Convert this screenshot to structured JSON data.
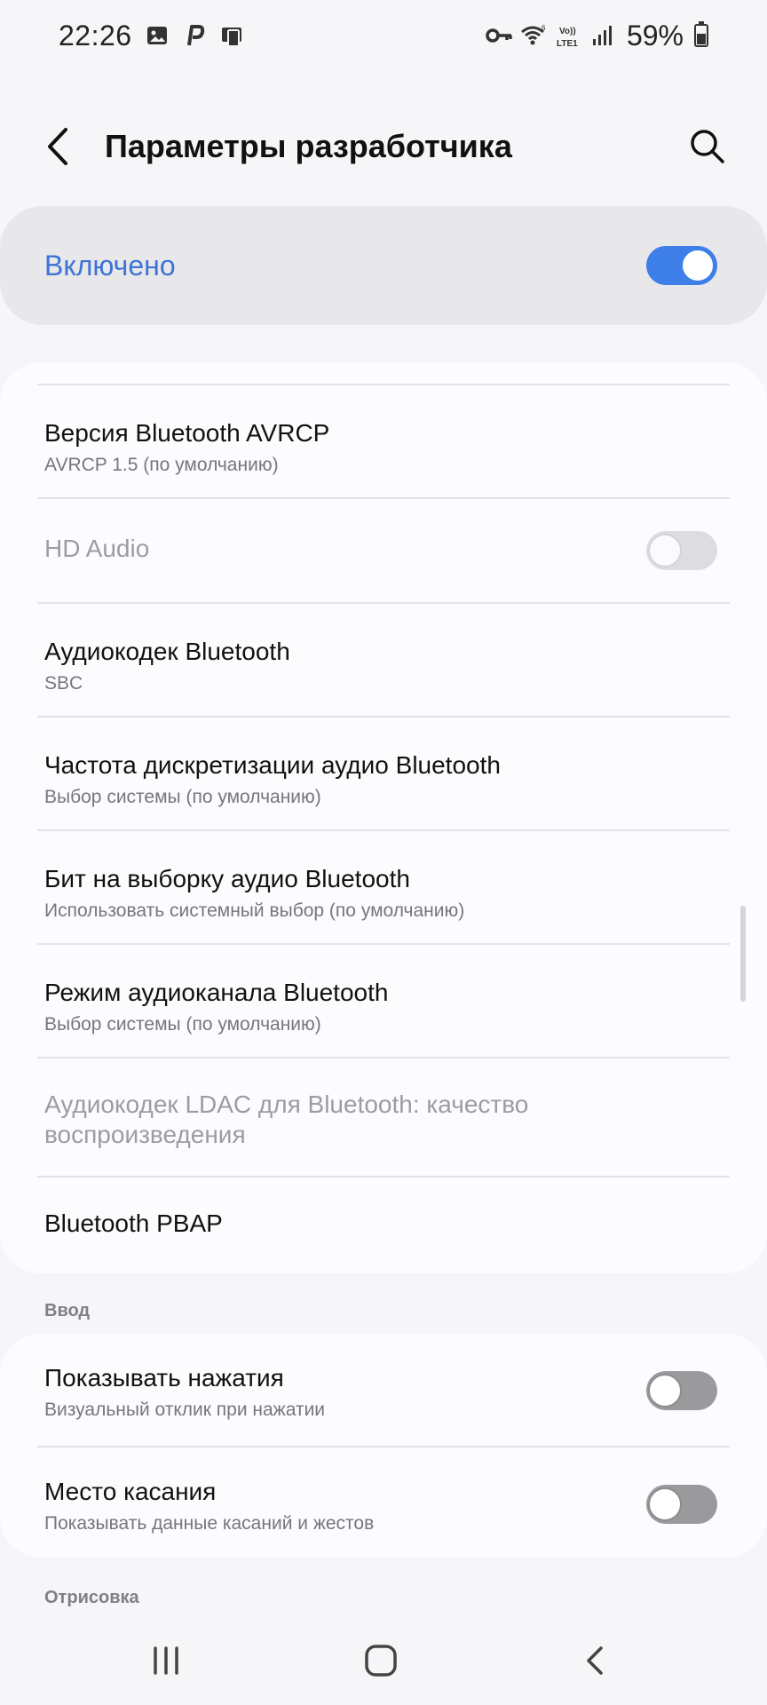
{
  "status_bar": {
    "time": "22:26",
    "battery": "59%",
    "left_icons": [
      "gallery-icon",
      "parking-icon",
      "device-icon"
    ],
    "right_icons": [
      "vpn-key-icon",
      "wifi-icon",
      "volte-icon",
      "signal-icon"
    ]
  },
  "header": {
    "title": "Параметры разработчика"
  },
  "master_switch": {
    "label": "Включено",
    "state": "on",
    "accent": "#3e74d6"
  },
  "bluetooth_items": [
    {
      "title": "Версия Bluetooth AVRCP",
      "subtitle": "AVRCP 1.5 (по умолчанию)"
    },
    {
      "title": "HD Audio",
      "toggle": "disabled"
    },
    {
      "title": "Аудиокодек Bluetooth",
      "subtitle": "SBC"
    },
    {
      "title": "Частота дискретизации аудио Bluetooth",
      "subtitle": "Выбор системы (по умолчанию)"
    },
    {
      "title": "Бит на выборку аудио Bluetooth",
      "subtitle": "Использовать системный выбор (по умолчанию)"
    },
    {
      "title": "Режим аудиоканала Bluetooth",
      "subtitle": "Выбор системы (по умолчанию)"
    },
    {
      "title_line1": "Аудиокодек LDAC для Bluetooth: качество",
      "title_line2": "воспроизведения",
      "enabled": false
    },
    {
      "title": "Bluetooth PBAP"
    }
  ],
  "input_section": {
    "label": "Ввод",
    "items": [
      {
        "title": "Показывать нажатия",
        "subtitle": "Визуальный отклик при нажатии",
        "toggle": "off"
      },
      {
        "title": "Место касания",
        "subtitle": "Показывать данные касаний и жестов",
        "toggle": "off"
      }
    ]
  },
  "drawing_section": {
    "label": "Отрисовка"
  },
  "nav_bar": {
    "buttons": [
      "recents-icon",
      "home-icon",
      "back-icon"
    ]
  }
}
